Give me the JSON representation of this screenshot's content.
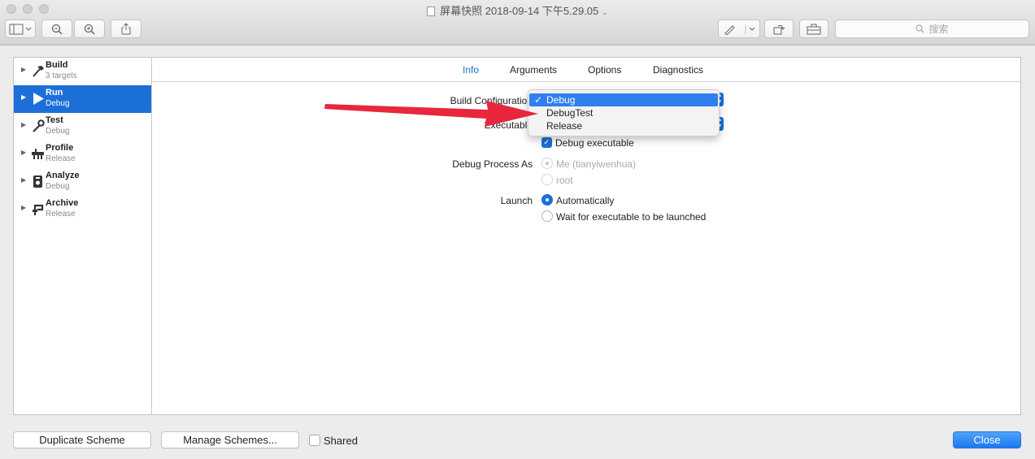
{
  "window": {
    "title": "屏幕快照 2018-09-14 下午5.29.05",
    "search_placeholder": "搜索"
  },
  "sidebar": {
    "items": [
      {
        "name": "Build",
        "sub": "3 targets",
        "icon": "hammer-icon"
      },
      {
        "name": "Run",
        "sub": "Debug",
        "icon": "play-icon",
        "selected": true
      },
      {
        "name": "Test",
        "sub": "Debug",
        "icon": "wrench-icon"
      },
      {
        "name": "Profile",
        "sub": "Release",
        "icon": "gauge-icon"
      },
      {
        "name": "Analyze",
        "sub": "Debug",
        "icon": "analyze-icon"
      },
      {
        "name": "Archive",
        "sub": "Release",
        "icon": "archive-icon"
      }
    ]
  },
  "tabs": [
    "Info",
    "Arguments",
    "Options",
    "Diagnostics"
  ],
  "active_tab": "Info",
  "form": {
    "build_configuration_label": "Build Configuration",
    "executable_label": "Executable",
    "debug_executable_label": "Debug executable",
    "debug_process_as_label": "Debug Process As",
    "debug_process_me": "Me (tianyiwenhua)",
    "debug_process_root": "root",
    "launch_label": "Launch",
    "launch_auto": "Automatically",
    "launch_wait": "Wait for executable to be launched"
  },
  "dropdown": {
    "check": "✓",
    "options": [
      "Debug",
      "DebugTest",
      "Release"
    ],
    "selected": "Debug"
  },
  "bottom": {
    "duplicate_label": "Duplicate Scheme",
    "manage_label": "Manage Schemes...",
    "shared_label": "Shared",
    "close_label": "Close"
  },
  "colors": {
    "accent": "#1d6fd8",
    "annotation_arrow": "#e8263c"
  }
}
